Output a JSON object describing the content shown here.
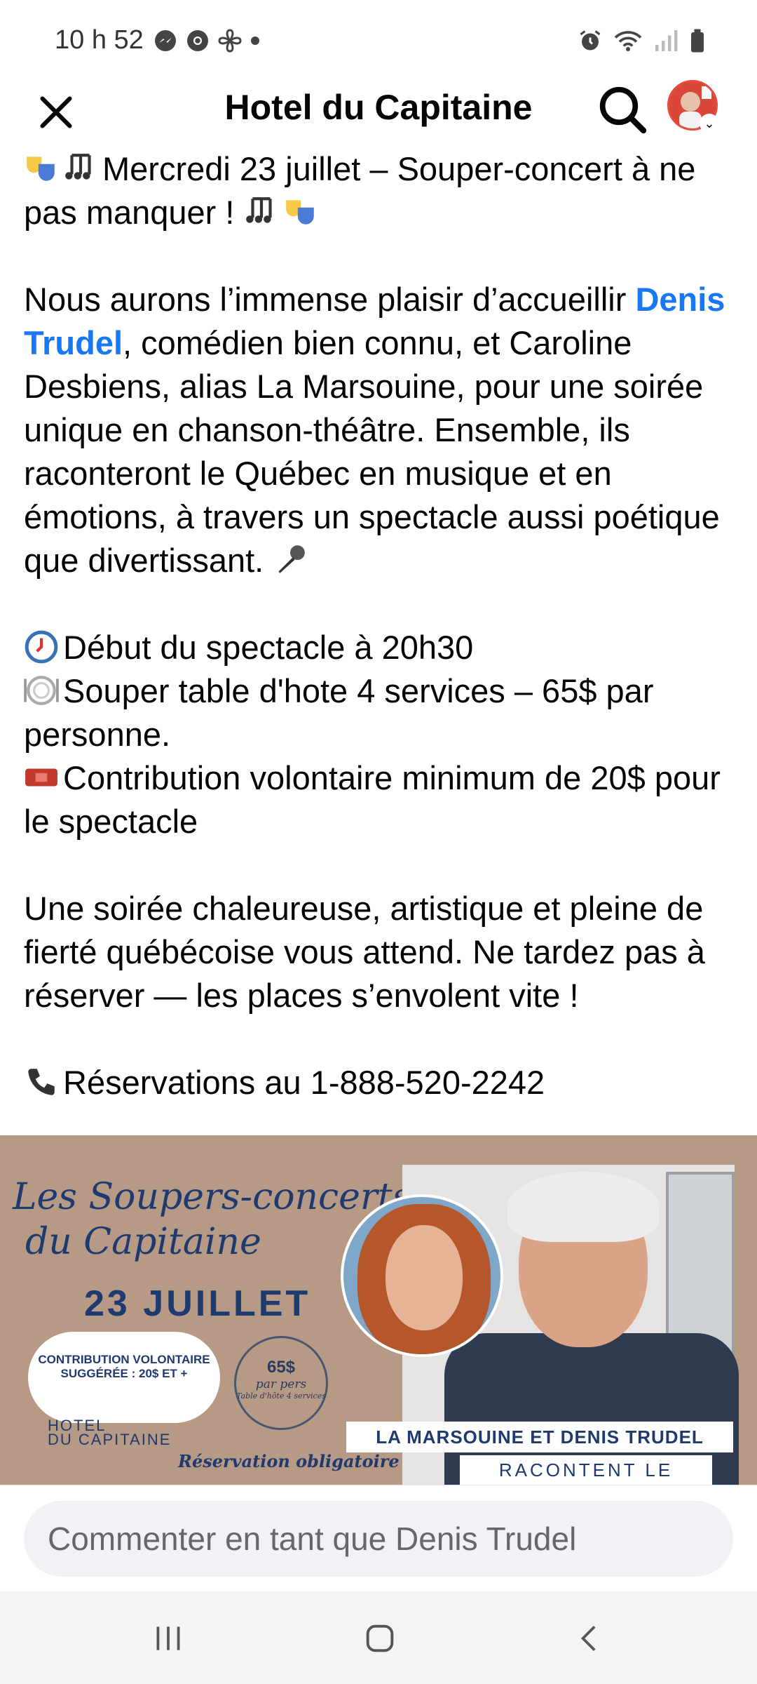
{
  "status_bar": {
    "time": "10 h 52",
    "left_icons": [
      "messenger-icon",
      "chrome-icon",
      "pinwheel-icon",
      "dot-icon"
    ],
    "right_icons": [
      "alarm-icon",
      "wifi-icon",
      "signal-icon",
      "battery-icon"
    ]
  },
  "header": {
    "title": "Hotel du Capitaine"
  },
  "post": {
    "line1": "Mercredi 23 juillet – Souper-concert à ne pas manquer !",
    "para1_before_link": "Nous aurons l’immense plaisir d’accueillir",
    "link": "Denis Trudel",
    "para1_after_link": ", comédien bien connu, et Caroline Desbiens, alias La Marsouine, pour une soirée unique en chanson-théâtre. Ensemble, ils raconteront le Québec en musique et en émotions, à travers un spectacle aussi poétique que divertissant.",
    "info1": "Début du spectacle à 20h30",
    "info2": "Souper table d'hote 4 services – 65$ par personne.",
    "info3": "Contribution volontaire minimum de 20$ pour le spectacle",
    "para2": "Une soirée chaleureuse, artistique et pleine de fierté québécoise vous attend. Ne tardez pas à réserver — les places s’envolent vite !",
    "phone": "Réservations au 1-888-520-2242"
  },
  "poster": {
    "script1": "Les Soupers-concerts",
    "script2": "du Capitaine",
    "date": "23 JUILLET",
    "contribution": "CONTRIBUTION VOLONTAIRE SUGGÉRÉE : 20$ ET +",
    "price": "65$",
    "price_sub": "par pers",
    "price_note": "Table d'hôte 4 services",
    "hotel_line1": "HOTEL",
    "hotel_line2": "DU CAPITAINE",
    "reservation": "Réservation obligatoire",
    "names": "LA MARSOUINE ET DENIS TRUDEL",
    "raconte": "RACONTENT LE"
  },
  "comment": {
    "placeholder": "Commenter en tant que Denis Trudel"
  },
  "colors": {
    "link": "#1877f2",
    "poster_bg": "#b79a86",
    "poster_ink": "#1f3a6e"
  }
}
